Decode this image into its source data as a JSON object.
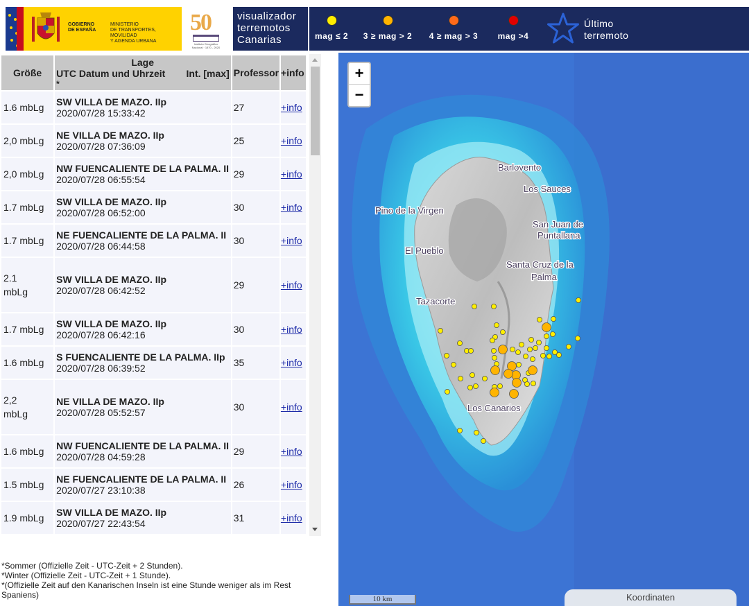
{
  "header": {
    "gov_line1": "GOBIERNO",
    "gov_line2": "DE ESPAÑA",
    "ministry_line1": "MINISTERIO",
    "ministry_line2": "DE TRANSPORTES, MOVILIDAD",
    "ministry_line3": "Y AGENDA URBANA",
    "anniv_number": "50",
    "anniv_caption": "Instituto Geográfico Nacional · 1870 - 2020",
    "title_line1": "visualizador",
    "title_line2": "terremotos",
    "title_line3": "Canarias",
    "legend": [
      {
        "label": "mag ≤ 2",
        "color": "#ffee00"
      },
      {
        "label": "3 ≥ mag > 2",
        "color": "#ffb400"
      },
      {
        "label": "4 ≥ mag > 3",
        "color": "#ff6a1a"
      },
      {
        "label": "mag >4",
        "color": "#e00000"
      }
    ],
    "last_quake_line1": "Último",
    "last_quake_line2": "terremoto",
    "star_icon": "star-icon",
    "star_color": "#2b62d6"
  },
  "table": {
    "headers": {
      "size": "Größe",
      "loc_line1": "Lage",
      "loc_line2": "UTC Datum und Uhrzeit",
      "loc_intensity": "Int. [max]",
      "loc_note": "*",
      "depth": "Professor",
      "info": "+info"
    },
    "rows": [
      {
        "mag": "1.6 mbLg",
        "place": "SW VILLA DE MAZO. IIp",
        "datetime": "2020/07/28 15:33:42",
        "depth": "27",
        "info": "+info",
        "big": false
      },
      {
        "mag": "2,0 mbLg",
        "place": "NE VILLA DE MAZO. IIp",
        "datetime": "2020/07/28 07:36:09",
        "depth": "25",
        "info": "+info",
        "big": false
      },
      {
        "mag": "2,0 mbLg",
        "place": "NW FUENCALIENTE DE LA PALMA. II",
        "datetime": "2020/07/28 06:55:54",
        "depth": "29",
        "info": "+info",
        "big": false
      },
      {
        "mag": "1.7 mbLg",
        "place": "SW VILLA DE MAZO. IIp",
        "datetime": "2020/07/28 06:52:00",
        "depth": "30",
        "info": "+info",
        "big": false
      },
      {
        "mag": "1.7 mbLg",
        "place": "NE FUENCALIENTE DE LA PALMA. II",
        "datetime": "2020/07/28 06:44:58",
        "depth": "30",
        "info": "+info",
        "big": false
      },
      {
        "mag": "2.1 mbLg",
        "place": "SW VILLA DE MAZO. IIp",
        "datetime": "2020/07/28 06:42:52",
        "depth": "29",
        "info": "+info",
        "big": true
      },
      {
        "mag": "1.7 mbLg",
        "place": "SW VILLA DE MAZO. IIp",
        "datetime": "2020/07/28 06:42:16",
        "depth": "30",
        "info": "+info",
        "big": false
      },
      {
        "mag": "1.6 mbLg",
        "place": "S FUENCALIENTE DE LA PALMA. IIp",
        "datetime": "2020/07/28 06:39:52",
        "depth": "35",
        "info": "+info",
        "big": false
      },
      {
        "mag": "2,2 mbLg",
        "place": "NE VILLA DE MAZO. IIp",
        "datetime": "2020/07/28 05:52:57",
        "depth": "30",
        "info": "+info",
        "big": true
      },
      {
        "mag": "1.6 mbLg",
        "place": "NW FUENCALIENTE DE LA PALMA. II",
        "datetime": "2020/07/28 04:59:28",
        "depth": "29",
        "info": "+info",
        "big": false
      },
      {
        "mag": "1.5 mbLg",
        "place": "NE FUENCALIENTE DE LA PALMA. II",
        "datetime": "2020/07/27 23:10:38",
        "depth": "26",
        "info": "+info",
        "big": false
      },
      {
        "mag": "1.9 mbLg",
        "place": "SW VILLA DE MAZO. IIp",
        "datetime": "2020/07/27 22:43:54",
        "depth": "31",
        "info": "+info",
        "big": false
      }
    ]
  },
  "notes": {
    "line1": "*Sommer (Offizielle Zeit - UTC-Zeit + 2 Stunden).",
    "line2": "*Winter (Offizielle Zeit - UTC-Zeit + 1 Stunde).",
    "line3": "*(Offizielle Zeit auf den Kanarischen Inseln ist eine Stunde weniger als im Rest Spaniens)"
  },
  "map": {
    "zoom_in": "+",
    "zoom_out": "−",
    "scale_label": "10 km",
    "coords_label": "Koordinaten",
    "towns": [
      "Barlovento",
      "Los Sauces",
      "Pino de la Virgen",
      "San Juan de",
      "Puntallana",
      "El Pueblo",
      "Santa Cruz de la",
      "Palma",
      "Tazacorte",
      "Los Canarios"
    ]
  }
}
